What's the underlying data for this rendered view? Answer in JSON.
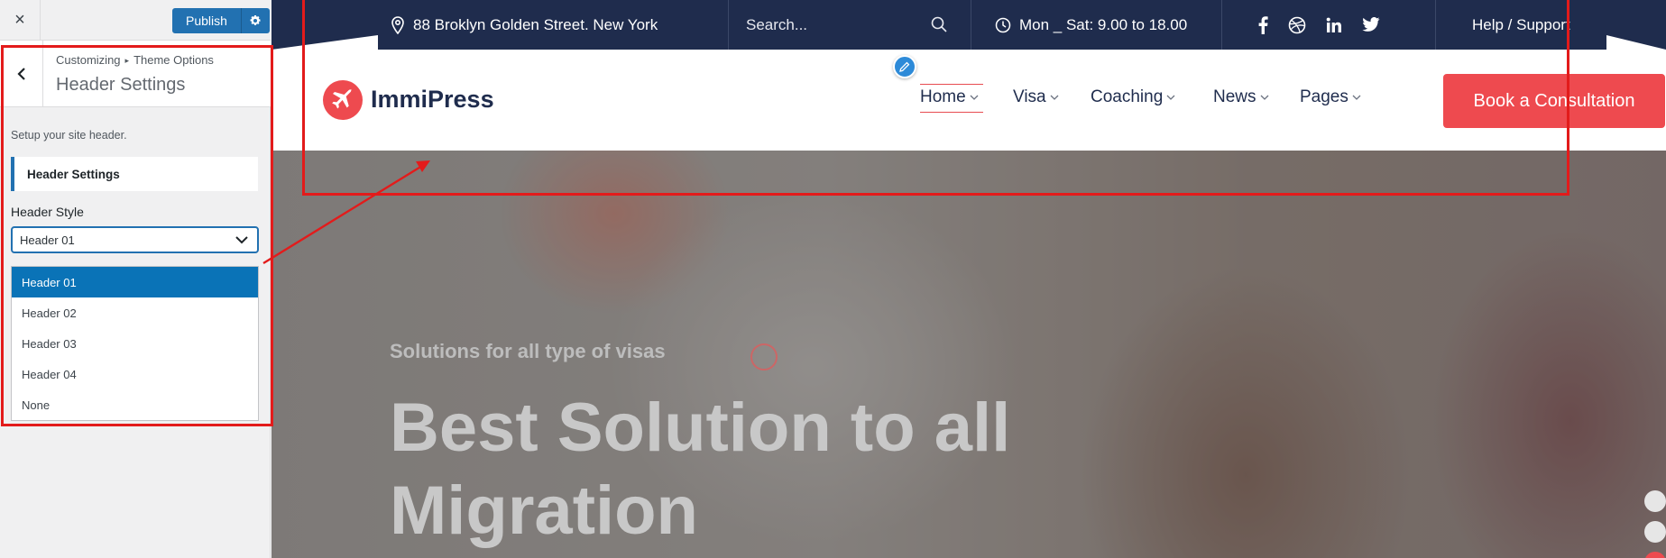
{
  "customizer": {
    "close_label": "×",
    "publish_label": "Publish",
    "breadcrumb": {
      "root": "Customizing",
      "separator": "▸",
      "parent": "Theme Options"
    },
    "section_title": "Header Settings",
    "description": "Setup your site header.",
    "subheading": "Header Settings",
    "field_label": "Header Style",
    "select_value": "Header 01",
    "options": [
      "Header 01",
      "Header 02",
      "Header 03",
      "Header 04",
      "None"
    ],
    "selected_option": "Header 01"
  },
  "preview": {
    "topbar": {
      "address": "88 Broklyn Golden Street. New York",
      "search_placeholder": "Search...",
      "hours": "Mon _ Sat: 9.00 to 18.00",
      "social_icons": [
        "facebook-icon",
        "dribbble-icon",
        "linkedin-icon",
        "twitter-icon"
      ],
      "help": "Help / Support"
    },
    "logo_text": "ImmiPress",
    "nav": [
      {
        "label": "Home",
        "active": true
      },
      {
        "label": "Visa"
      },
      {
        "label": "Coaching"
      },
      {
        "label": "News"
      },
      {
        "label": "Pages"
      }
    ],
    "cta": "Book a Consultation",
    "hero": {
      "subtitle": "Solutions for all type of visas",
      "title": "Best Solution to all Migration"
    }
  },
  "colors": {
    "accent": "#2271b1",
    "brand_red": "#ee4a4f",
    "navy": "#1f2c4d",
    "annotation": "#e31b1b"
  }
}
